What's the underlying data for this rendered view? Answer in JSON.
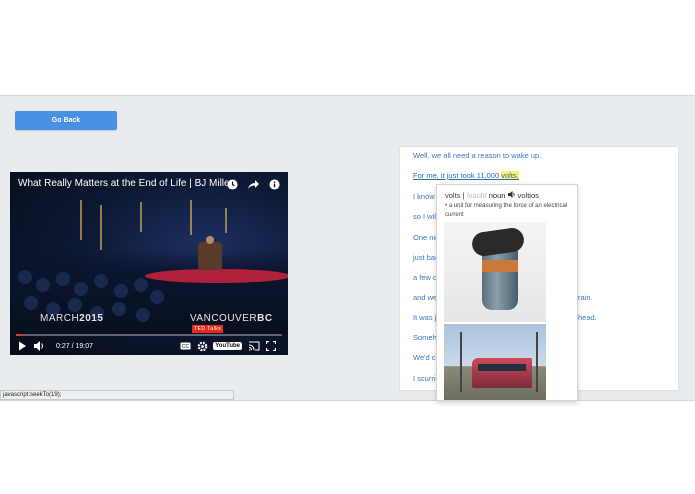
{
  "go_back_label": "Go Back",
  "video": {
    "title": "What Really Matters at the End of Life | BJ Miller | ...",
    "caption_left_light": "MARCH",
    "caption_left_bold": "2015",
    "caption_right_light": "VANCOUVER",
    "caption_right_bold": "BC",
    "badge": "TED Talks",
    "time": "0:27 / 19:07",
    "progress": 0.024,
    "youtube_label": "YouTube",
    "icons": [
      "clock-icon",
      "share-icon",
      "info-icon",
      "play-icon",
      "volume-icon",
      "cc-icon",
      "settings-icon",
      "cast-icon",
      "fullscreen-icon"
    ]
  },
  "status_bar": "javascript:seekTo(19);",
  "transcript": {
    "lines": [
      "Well, we all need a reason to wake up.",
      "For me, it just took 11,000",
      "I know",
      "so I wil",
      "One nig",
      "just bac",
      "a few o",
      "and we",
      "It was ju",
      "Someh",
      "We'd c",
      "I scurrie"
    ],
    "current_line_suffix": "volts.",
    "overflow": {
      "line7": "rain.",
      "line8": "head."
    }
  },
  "dictionary_popup": {
    "word": "volts",
    "sep": "|",
    "ipa": "/vəʊlt/",
    "pos": "noun",
    "audio_label": "voltios",
    "definition": "• a unit for measuring the force of an electrical current"
  },
  "colors": {
    "accent": "#4a90e2",
    "link": "#3a79b9",
    "highlight": "#fff36b",
    "progress": "#e53935"
  }
}
